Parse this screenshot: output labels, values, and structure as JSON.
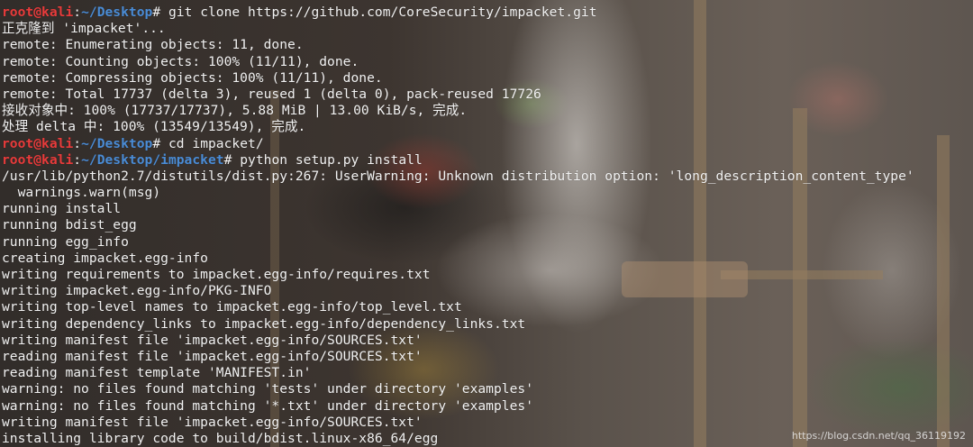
{
  "terminal": {
    "lines": [
      {
        "type": "prompt",
        "user": "root@kali",
        "path": "~/Desktop",
        "command": "git clone https://github.com/CoreSecurity/impacket.git"
      },
      {
        "type": "out",
        "text": "正克隆到 'impacket'..."
      },
      {
        "type": "out",
        "text": "remote: Enumerating objects: 11, done."
      },
      {
        "type": "out",
        "text": "remote: Counting objects: 100% (11/11), done."
      },
      {
        "type": "out",
        "text": "remote: Compressing objects: 100% (11/11), done."
      },
      {
        "type": "out",
        "text": "remote: Total 17737 (delta 3), reused 1 (delta 0), pack-reused 17726"
      },
      {
        "type": "out",
        "text": "接收对象中: 100% (17737/17737), 5.88 MiB | 13.00 KiB/s, 完成."
      },
      {
        "type": "out",
        "text": "处理 delta 中: 100% (13549/13549), 完成."
      },
      {
        "type": "prompt",
        "user": "root@kali",
        "path": "~/Desktop",
        "command": "cd impacket/"
      },
      {
        "type": "prompt",
        "user": "root@kali",
        "path": "~/Desktop/impacket",
        "command": "python setup.py install"
      },
      {
        "type": "out",
        "text": "/usr/lib/python2.7/distutils/dist.py:267: UserWarning: Unknown distribution option: 'long_description_content_type'"
      },
      {
        "type": "out",
        "text": "  warnings.warn(msg)"
      },
      {
        "type": "out",
        "text": "running install"
      },
      {
        "type": "out",
        "text": "running bdist_egg"
      },
      {
        "type": "out",
        "text": "running egg_info"
      },
      {
        "type": "out",
        "text": "creating impacket.egg-info"
      },
      {
        "type": "out",
        "text": "writing requirements to impacket.egg-info/requires.txt"
      },
      {
        "type": "out",
        "text": "writing impacket.egg-info/PKG-INFO"
      },
      {
        "type": "out",
        "text": "writing top-level names to impacket.egg-info/top_level.txt"
      },
      {
        "type": "out",
        "text": "writing dependency_links to impacket.egg-info/dependency_links.txt"
      },
      {
        "type": "out",
        "text": "writing manifest file 'impacket.egg-info/SOURCES.txt'"
      },
      {
        "type": "out",
        "text": "reading manifest file 'impacket.egg-info/SOURCES.txt'"
      },
      {
        "type": "out",
        "text": "reading manifest template 'MANIFEST.in'"
      },
      {
        "type": "out",
        "text": "warning: no files found matching 'tests' under directory 'examples'"
      },
      {
        "type": "out",
        "text": "warning: no files found matching '*.txt' under directory 'examples'"
      },
      {
        "type": "out",
        "text": "writing manifest file 'impacket.egg-info/SOURCES.txt'"
      },
      {
        "type": "out",
        "text": "installing library code to build/bdist.linux-x86_64/egg"
      }
    ]
  },
  "watermark": "https://blog.csdn.net/qq_36119192",
  "colors": {
    "user": "#e83b3b",
    "path": "#4a8cd6",
    "text": "#f2f2f2"
  }
}
